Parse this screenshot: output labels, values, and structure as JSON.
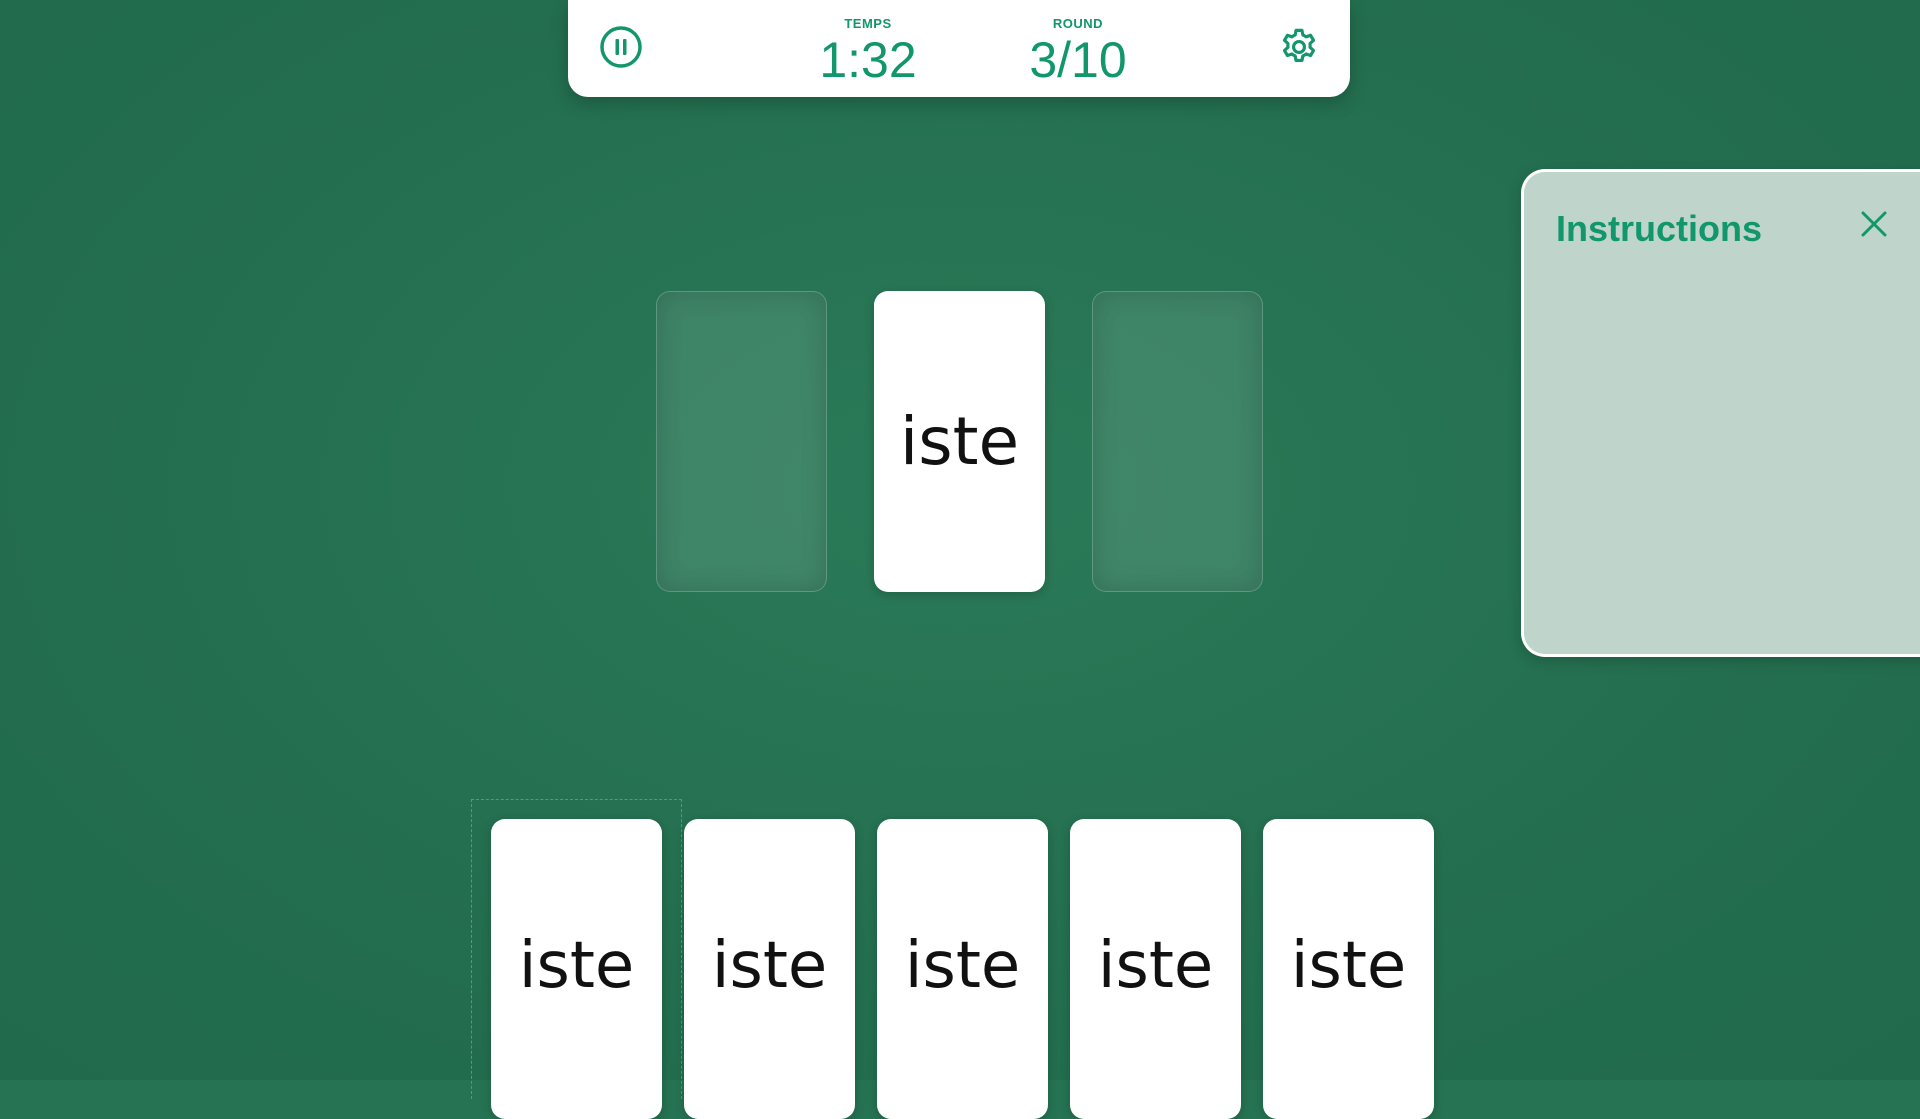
{
  "hud": {
    "time_label": "TEMPS",
    "time_value": "1:32",
    "round_label": "ROUND",
    "round_value": "3/10",
    "pause_icon": "pause-icon",
    "settings_icon": "gear-icon"
  },
  "table": {
    "center_card": "iste"
  },
  "hand": {
    "cards": [
      "iste",
      "iste",
      "iste",
      "iste",
      "iste"
    ]
  },
  "instructions": {
    "title": "Instructions",
    "close_icon": "close-icon"
  },
  "colors": {
    "felt": "#257352",
    "accent": "#12966b",
    "panel": "#bfd5cb"
  }
}
